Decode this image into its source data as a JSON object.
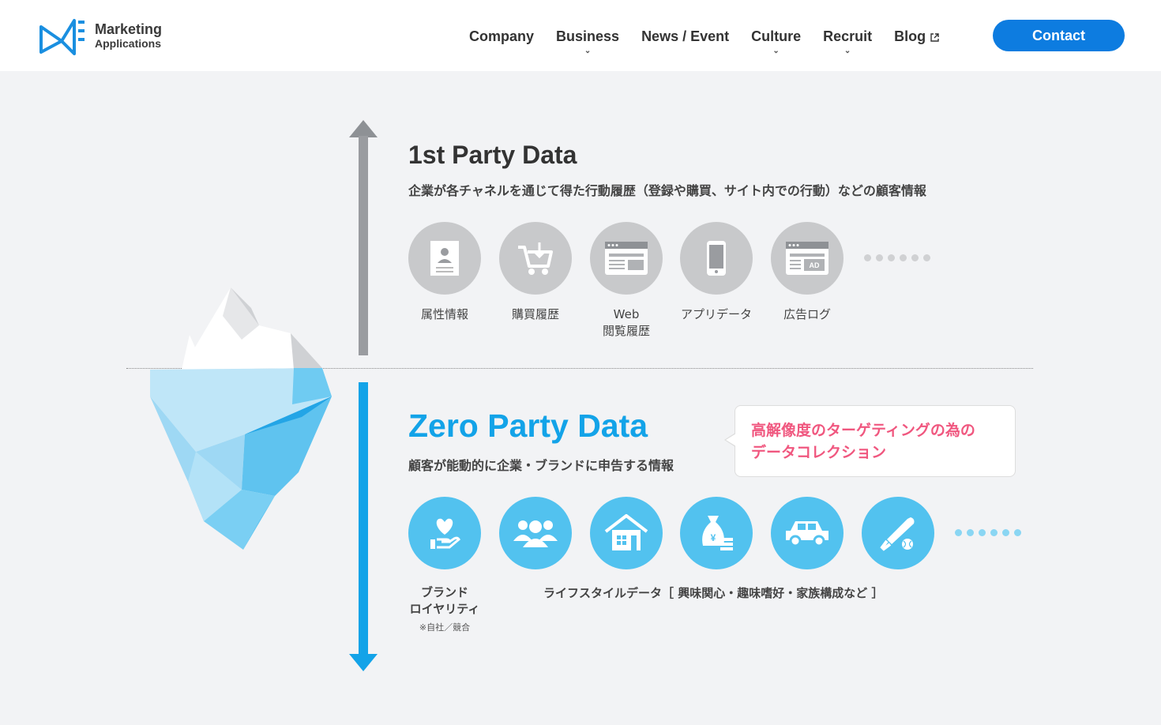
{
  "brand": {
    "name_line1": "Marketing",
    "name_line2": "Applications"
  },
  "nav": {
    "items": [
      {
        "label": "Company",
        "has_dropdown": false
      },
      {
        "label": "Business",
        "has_dropdown": true
      },
      {
        "label": "News / Event",
        "has_dropdown": false
      },
      {
        "label": "Culture",
        "has_dropdown": true
      },
      {
        "label": "Recruit",
        "has_dropdown": true
      },
      {
        "label": "Blog",
        "has_dropdown": false,
        "external": true
      }
    ],
    "contact_label": "Contact"
  },
  "first_party": {
    "title": "1st Party Data",
    "description": "企業が各チャネルを通じて得た行動履歴（登録や購買、サイト内での行動）などの顧客情報",
    "items": [
      {
        "icon": "profile-card-icon",
        "label_line1": "属性情報",
        "label_line2": ""
      },
      {
        "icon": "shopping-cart-icon",
        "label_line1": "購買履歴",
        "label_line2": ""
      },
      {
        "icon": "browser-window-icon",
        "label_line1": "Web",
        "label_line2": "閲覧履歴"
      },
      {
        "icon": "smartphone-icon",
        "label_line1": "アプリデータ",
        "label_line2": ""
      },
      {
        "icon": "ad-browser-icon",
        "label_line1": "広告ログ",
        "label_line2": ""
      }
    ]
  },
  "zero_party": {
    "title": "Zero Party Data",
    "description": "顧客が能動的に企業・ブランドに申告する情報",
    "callout_line1": "高解像度のターゲティングの為の",
    "callout_line2": "データコレクション",
    "items": [
      {
        "icon": "heart-hand-icon"
      },
      {
        "icon": "people-group-icon"
      },
      {
        "icon": "house-icon"
      },
      {
        "icon": "money-bag-icon"
      },
      {
        "icon": "car-icon"
      },
      {
        "icon": "baseball-bat-icon"
      }
    ],
    "brand_label_line1": "ブランド",
    "brand_label_line2": "ロイヤリティ",
    "brand_note": "※自社／競合",
    "lifestyle_label": "ライフスタイルデータ［ 興味関心・趣味嗜好・家族構成など ］"
  },
  "colors": {
    "accent_blue": "#0d7ce0",
    "zero_blue": "#13a3e8",
    "callout_pink": "#f0577f",
    "gray_circle": "#c8c9cb",
    "blue_circle": "#52c2ef"
  }
}
